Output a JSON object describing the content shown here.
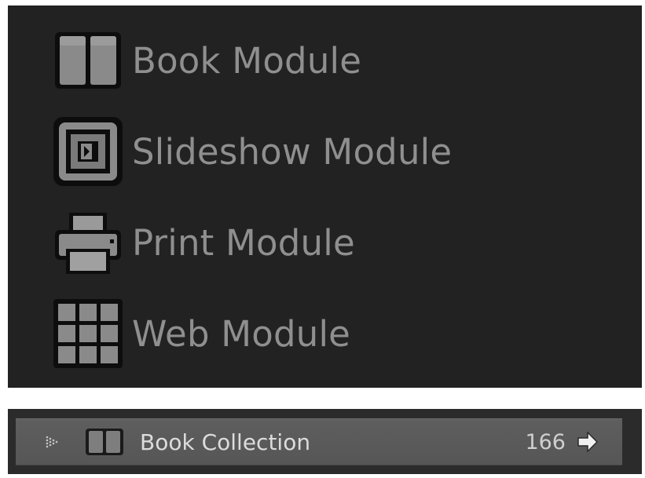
{
  "modules": [
    {
      "id": "book",
      "label": "Book Module",
      "icon": "book-icon"
    },
    {
      "id": "slideshow",
      "label": "Slideshow Module",
      "icon": "slideshow-icon"
    },
    {
      "id": "print",
      "label": "Print Module",
      "icon": "printer-icon"
    },
    {
      "id": "web",
      "label": "Web Module",
      "icon": "web-grid-icon"
    }
  ],
  "collection": {
    "name": "Book Collection",
    "count": "166",
    "icon": "book-icon",
    "disclosure_icon": "disclosure-triangle-icon",
    "action_icon": "arrow-right-icon"
  },
  "colors": {
    "panel_bg": "#232223",
    "label": "#8f8f8f",
    "collection_bar": "#5a595a",
    "collection_text": "#dcdcdc"
  }
}
